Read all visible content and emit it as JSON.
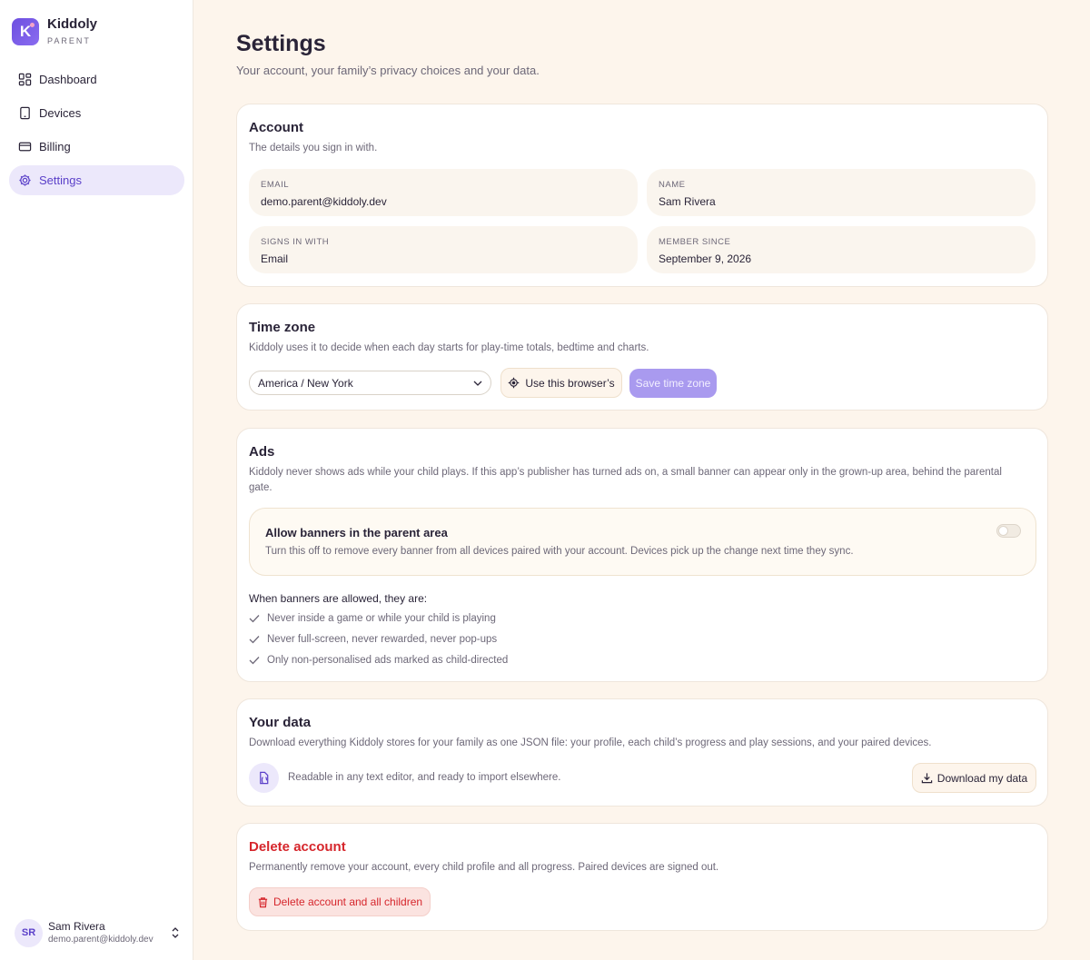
{
  "app": {
    "logo_letter": "K",
    "name": "Kiddoly",
    "subtitle": "PARENT"
  },
  "sidebar": {
    "items": [
      {
        "label": "Dashboard",
        "icon": "grid-icon",
        "active": false
      },
      {
        "label": "Devices",
        "icon": "tablet-icon",
        "active": false
      },
      {
        "label": "Billing",
        "icon": "credit-card-icon",
        "active": false
      },
      {
        "label": "Settings",
        "icon": "gear-icon",
        "active": true
      }
    ],
    "user": {
      "initials": "SR",
      "name": "Sam Rivera",
      "email": "demo.parent@kiddoly.dev"
    }
  },
  "page": {
    "title": "Settings",
    "subtitle": "Your account, your family’s privacy choices and your data."
  },
  "account": {
    "title": "Account",
    "desc": "The details you sign in with.",
    "fields": [
      {
        "label": "EMAIL",
        "value": "demo.parent@kiddoly.dev"
      },
      {
        "label": "NAME",
        "value": "Sam Rivera"
      },
      {
        "label": "SIGNS IN WITH",
        "value": "Email"
      },
      {
        "label": "MEMBER SINCE",
        "value": "September 9, 2026"
      }
    ]
  },
  "timezone": {
    "title": "Time zone",
    "desc": "Kiddoly uses it to decide when each day starts for play-time totals, bedtime and charts.",
    "selected": "America / New York",
    "use_browser_label": "Use this browser’s",
    "save_label": "Save time zone"
  },
  "ads": {
    "title": "Ads",
    "desc": "Kiddoly never shows ads while your child plays. If this app’s publisher has turned ads on, a small banner can appear only in the grown-up area, behind the parental gate.",
    "toggle_title": "Allow banners in the parent area",
    "toggle_desc": "Turn this off to remove every banner from all devices paired with your account. Devices pick up the change next time they sync.",
    "toggle_on": false,
    "rules_title": "When banners are allowed, they are:",
    "rules": [
      "Never inside a game or while your child is playing",
      "Never full-screen, never rewarded, never pop-ups",
      "Only non-personalised ads marked as child-directed"
    ]
  },
  "data": {
    "title": "Your data",
    "desc": "Download everything Kiddoly stores for your family as one JSON file: your profile, each child’s progress and play sessions, and your paired devices.",
    "note": "Readable in any text editor, and ready to import elsewhere.",
    "download_label": "Download my data"
  },
  "delete": {
    "title": "Delete account",
    "desc": "Permanently remove your account, every child profile and all progress. Paired devices are signed out.",
    "button_label": "Delete account and all children"
  },
  "colors": {
    "accent": "#5b40c9",
    "background": "#fdf5ec",
    "danger": "#d6262c"
  }
}
